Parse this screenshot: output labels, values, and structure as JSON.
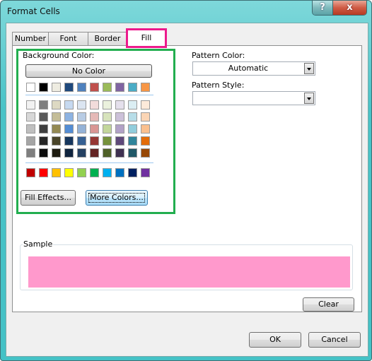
{
  "window": {
    "title": "Format Cells",
    "help_button": "?",
    "close_button": "x"
  },
  "tabs": [
    {
      "label": "Number",
      "active": false
    },
    {
      "label": "Font",
      "active": false
    },
    {
      "label": "Border",
      "active": false
    },
    {
      "label": "Fill",
      "active": true
    }
  ],
  "fill": {
    "background_color_label": "Background Color:",
    "no_color_label": "No Color",
    "theme_row": [
      "#ffffff",
      "#000000",
      "#eeece1",
      "#1f497d",
      "#4f81bd",
      "#c0504d",
      "#9bbb59",
      "#8064a2",
      "#4bacc6",
      "#f79646"
    ],
    "tint_rows": [
      [
        "#f2f2f2",
        "#7f7f7f",
        "#ddd9c3",
        "#c6d9f0",
        "#dbe5f1",
        "#f2dcdb",
        "#ebf1dd",
        "#e5e0ec",
        "#dbeef3",
        "#fdeada"
      ],
      [
        "#d8d8d8",
        "#595959",
        "#c4bd97",
        "#8db3e2",
        "#b8cce4",
        "#e5b9b7",
        "#d7e3bc",
        "#ccc1d9",
        "#b7dde8",
        "#fbd5b5"
      ],
      [
        "#bfbfbf",
        "#3f3f3f",
        "#938953",
        "#548dd4",
        "#95b3d7",
        "#d99694",
        "#c3d69b",
        "#b2a2c7",
        "#92cddc",
        "#fac08f"
      ],
      [
        "#a5a5a5",
        "#262626",
        "#494429",
        "#17365d",
        "#366092",
        "#953734",
        "#76923c",
        "#5f497a",
        "#31859b",
        "#e36c09"
      ],
      [
        "#7f7f7f",
        "#0c0c0c",
        "#1d1b10",
        "#0f243e",
        "#244061",
        "#632423",
        "#4f6128",
        "#3f3151",
        "#205867",
        "#974806"
      ]
    ],
    "standard_row": [
      "#c00000",
      "#ff0000",
      "#ffc000",
      "#ffff00",
      "#92d050",
      "#00b050",
      "#00b0f0",
      "#0070c0",
      "#002060",
      "#7030a0"
    ],
    "fill_effects_label": "Fill Effects...",
    "more_colors_label": "More Colors...",
    "pattern_color_label": "Pattern Color:",
    "pattern_color_value": "Automatic",
    "pattern_style_label": "Pattern Style:",
    "pattern_style_value": "",
    "sample_label": "Sample",
    "sample_color": "#ff99cc",
    "clear_label": "Clear"
  },
  "footer": {
    "ok_label": "OK",
    "cancel_label": "Cancel"
  },
  "highlight_colors": {
    "tab_highlight": "#ec1a8c",
    "group_highlight": "#22ae4f"
  }
}
